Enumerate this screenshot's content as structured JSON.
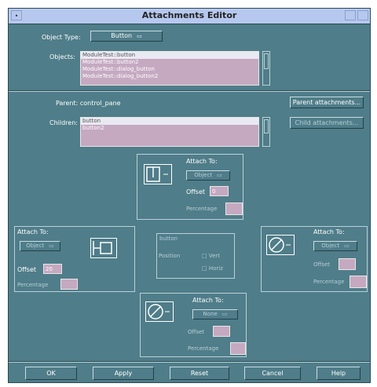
{
  "window": {
    "title": "Attachments Editor"
  },
  "object_type": {
    "label": "Object Type:",
    "value": "Button"
  },
  "objects": {
    "label": "Objects:",
    "items": [
      "ModuleTest::button",
      "ModuleTest::button2",
      "ModuleTest::dialog_button",
      "ModuleTest::dialog_button2"
    ]
  },
  "parent": {
    "label": "Parent:",
    "value": "control_pane",
    "attachments_button": "Parent attachments..."
  },
  "children": {
    "label": "Children:",
    "items": [
      "button",
      "button2"
    ],
    "attachments_button": "Child attachments..."
  },
  "top_attach": {
    "label": "Attach To:",
    "value": "Object",
    "offset_label": "Offset",
    "offset_value": "0",
    "percentage_label": "Percentage"
  },
  "left_attach": {
    "label": "Attach To:",
    "value": "Object",
    "offset_label": "Offset",
    "offset_value": "20",
    "percentage_label": "Percentage"
  },
  "center_box": {
    "label": "button",
    "position_label": "Position",
    "center_v": "Vert",
    "center_h": "Horiz"
  },
  "right_attach": {
    "label": "Attach To:",
    "value": "Object",
    "offset_label": "Offset",
    "percentage_label": "Percentage"
  },
  "bottom_attach": {
    "label": "Attach To:",
    "value": "None",
    "offset_label": "Offset",
    "percentage_label": "Percentage"
  },
  "buttons": {
    "ok": "OK",
    "apply": "Apply",
    "reset": "Reset",
    "cancel": "Cancel",
    "help": "Help"
  },
  "colors": {
    "background": "#4f7d89",
    "titlebar": "#b7c8ef",
    "field": "#c5a9c1"
  }
}
